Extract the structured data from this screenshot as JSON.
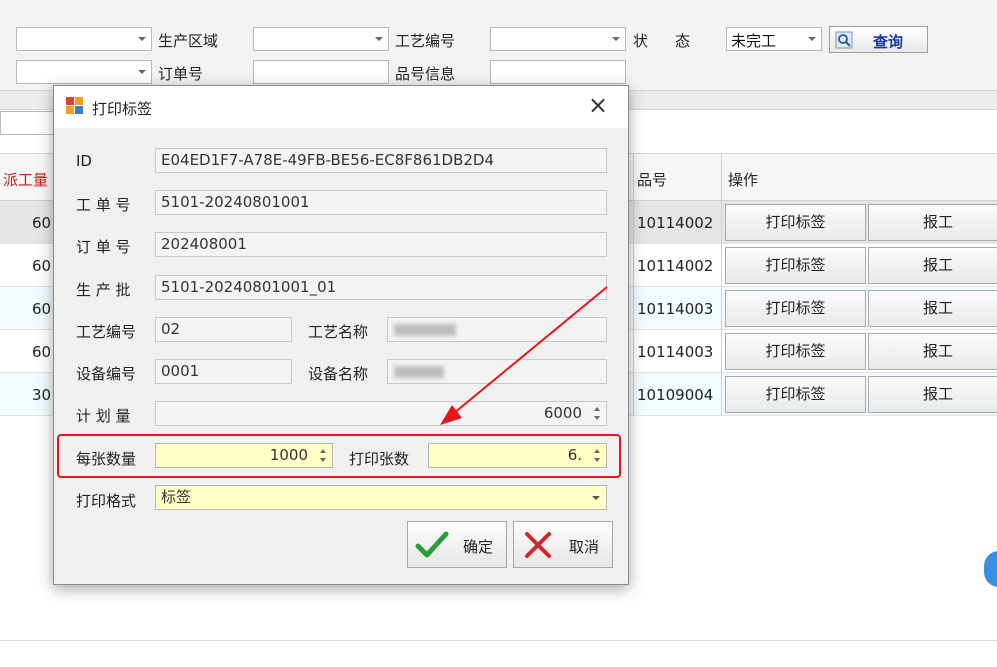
{
  "filters": {
    "row1": [
      {
        "label": "生产区域"
      },
      {
        "label": "工艺编号"
      },
      {
        "label": "状　态",
        "value": "未完工"
      }
    ],
    "row2": [
      {
        "label": "订单号"
      },
      {
        "label": "品号信息"
      }
    ],
    "query_button": "查询"
  },
  "grid": {
    "headers": {
      "dispatch_qty": "派工量",
      "item_no": "品号",
      "operation": "操作"
    },
    "rows": [
      {
        "qty": "60",
        "item_no": "10114002",
        "print": "打印标签",
        "report": "报工"
      },
      {
        "qty": "60",
        "item_no": "10114002",
        "print": "打印标签",
        "report": "报工"
      },
      {
        "qty": "60",
        "item_no": "10114003",
        "print": "打印标签",
        "report": "报工"
      },
      {
        "qty": "60",
        "item_no": "10114003",
        "print": "打印标签",
        "report": "报工"
      },
      {
        "qty": "30",
        "item_no": "10109004",
        "print": "打印标签",
        "report": "报工"
      }
    ]
  },
  "dialog": {
    "title": "打印标签",
    "close": "×",
    "fields": {
      "id_label": "ID",
      "id_value": "E04ED1F7-A78E-49FB-BE56-EC8F861DB2D4",
      "work_order_label": "工 单 号",
      "work_order_value": "5101-20240801001",
      "order_label": "订 单 号",
      "order_value": "202408001",
      "batch_label": "生 产 批",
      "batch_value": "5101-20240801001_01",
      "process_no_label": "工艺编号",
      "process_no_value": "02",
      "process_name_label": "工艺名称",
      "device_no_label": "设备编号",
      "device_no_value": "0001",
      "device_name_label": "设备名称",
      "plan_qty_label": "计 划 量",
      "plan_qty_value": "6000",
      "per_sheet_label": "每张数量",
      "per_sheet_value": "1000",
      "sheets_label": "打印张数",
      "sheets_value": "6.",
      "format_label": "打印格式",
      "format_value": "标签"
    },
    "ok_button": "确定",
    "cancel_button": "取消"
  },
  "colors": {
    "highlight_border": "#e8141c",
    "arrow": "#e8141c",
    "query_text": "#1a3c9c",
    "header_red": "#c0201c",
    "ok_green": "#2a9d3a",
    "cancel_red": "#d0262c"
  }
}
